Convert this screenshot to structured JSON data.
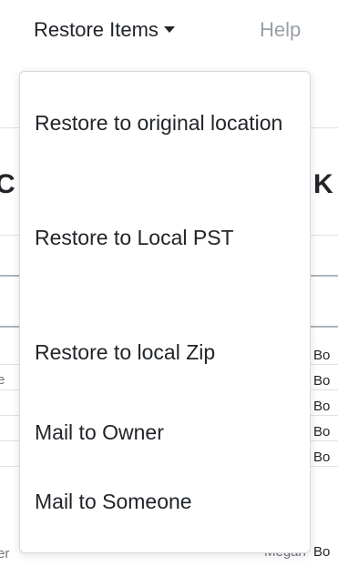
{
  "nav": {
    "restore_label": "Restore Items",
    "help_label": "Help"
  },
  "background": {
    "heading_left": "C",
    "heading_right": "K",
    "rows": [
      {
        "left": "e",
        "right": "Bo"
      },
      {
        "left": "",
        "right": "Bo"
      },
      {
        "left": "",
        "right": "Bo"
      },
      {
        "left": "",
        "right": "Bo"
      },
      {
        "left": "",
        "right": "Bo"
      },
      {
        "left": "er",
        "middle": "Megan",
        "right": "Bo"
      }
    ]
  },
  "dropdown": {
    "items": [
      {
        "label": "Restore to original location"
      },
      {
        "label": "Restore to Local PST"
      },
      {
        "label": "Restore to local Zip"
      },
      {
        "label": "Mail to Owner"
      },
      {
        "label": "Mail to Someone"
      }
    ]
  }
}
